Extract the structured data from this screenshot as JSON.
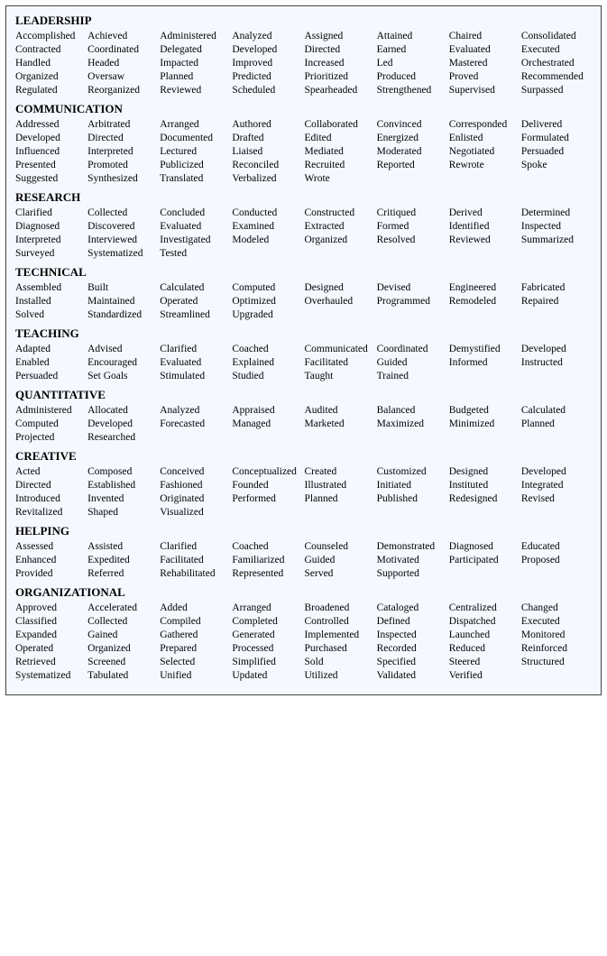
{
  "sections": [
    {
      "id": "leadership",
      "title": "LEADERSHIP",
      "words": [
        "Accomplished",
        "Achieved",
        "Administered",
        "Analyzed",
        "Assigned",
        "Attained",
        "Chaired",
        "Consolidated",
        "Contracted",
        "Coordinated",
        "Delegated",
        "Developed",
        "Directed",
        "Earned",
        "Evaluated",
        "Executed",
        "Handled",
        "Headed",
        "Impacted",
        "Improved",
        "Increased",
        "Led",
        "Mastered",
        "Orchestrated",
        "Organized",
        "Oversaw",
        "Planned",
        "Predicted",
        "Prioritized",
        "Produced",
        "Proved",
        "Recommended",
        "Regulated",
        "Reorganized",
        "Reviewed",
        "Scheduled",
        "Spearheaded",
        "Strengthened",
        "Supervised",
        "Surpassed"
      ]
    },
    {
      "id": "communication",
      "title": "COMMUNICATION",
      "words": [
        "Addressed",
        "Arbitrated",
        "Arranged",
        "Authored",
        "Collaborated",
        "Convinced",
        "Corresponded",
        "Delivered",
        "Developed",
        "Directed",
        "Documented",
        "Drafted",
        "Edited",
        "Energized",
        "Enlisted",
        "Formulated",
        "Influenced",
        "Interpreted",
        "Lectured",
        "Liaised",
        "Mediated",
        "Moderated",
        "Negotiated",
        "Persuaded",
        "Presented",
        "Promoted",
        "Publicized",
        "Reconciled",
        "Recruited",
        "Reported",
        "Rewrote",
        "Spoke",
        "Suggested",
        "Synthesized",
        "Translated",
        "Verbalized",
        "Wrote",
        "",
        "",
        ""
      ]
    },
    {
      "id": "research",
      "title": "RESEARCH",
      "words": [
        "Clarified",
        "Collected",
        "Concluded",
        "Conducted",
        "Constructed",
        "Critiqued",
        "Derived",
        "Determined",
        "Diagnosed",
        "Discovered",
        "Evaluated",
        "Examined",
        "Extracted",
        "Formed",
        "Identified",
        "Inspected",
        "Interpreted",
        "Interviewed",
        "Investigated",
        "Modeled",
        "Organized",
        "Resolved",
        "Reviewed",
        "Summarized",
        "Surveyed",
        "Systematized",
        "Tested",
        "",
        "",
        "",
        "",
        ""
      ]
    },
    {
      "id": "technical",
      "title": "TECHNICAL",
      "words": [
        "Assembled",
        "Built",
        "Calculated",
        "Computed",
        "Designed",
        "Devised",
        "Engineered",
        "Fabricated",
        "Installed",
        "Maintained",
        "Operated",
        "Optimized",
        "Overhauled",
        "Programmed",
        "Remodeled",
        "Repaired",
        "Solved",
        "Standardized",
        "Streamlined",
        "Upgraded",
        "",
        "",
        "",
        ""
      ]
    },
    {
      "id": "teaching",
      "title": "TEACHING",
      "words": [
        "Adapted",
        "Advised",
        "Clarified",
        "Coached",
        "Communicated",
        "Coordinated",
        "Demystified",
        "Developed",
        "Enabled",
        "Encouraged",
        "Evaluated",
        "Explained",
        "Facilitated",
        "Guided",
        "Informed",
        "Instructed",
        "Persuaded",
        "Set Goals",
        "Stimulated",
        "Studied",
        "Taught",
        "Trained",
        "",
        ""
      ]
    },
    {
      "id": "quantitative",
      "title": "QUANTITATIVE",
      "words": [
        "Administered",
        "Allocated",
        "Analyzed",
        "Appraised",
        "Audited",
        "Balanced",
        "Budgeted",
        "Calculated",
        "Computed",
        "Developed",
        "Forecasted",
        "Managed",
        "Marketed",
        "Maximized",
        "Minimized",
        "Planned",
        "Projected",
        "Researched",
        "",
        "",
        "",
        "",
        "",
        ""
      ]
    },
    {
      "id": "creative",
      "title": "CREATIVE",
      "words": [
        "Acted",
        "Composed",
        "Conceived",
        "Conceptualized",
        "Created",
        "Customized",
        "Designed",
        "Developed",
        "Directed",
        "Established",
        "Fashioned",
        "Founded",
        "Illustrated",
        "Initiated",
        "Instituted",
        "Integrated",
        "Introduced",
        "Invented",
        "Originated",
        "Performed",
        "Planned",
        "Published",
        "Redesigned",
        "Revised",
        "Revitalized",
        "Shaped",
        "Visualized",
        "",
        "",
        "",
        "",
        ""
      ]
    },
    {
      "id": "helping",
      "title": "HELPING",
      "words": [
        "Assessed",
        "Assisted",
        "Clarified",
        "Coached",
        "Counseled",
        "Demonstrated",
        "Diagnosed",
        "Educated",
        "Enhanced",
        "Expedited",
        "Facilitated",
        "Familiarized",
        "Guided",
        "Motivated",
        "Participated",
        "Proposed",
        "Provided",
        "Referred",
        "Rehabilitated",
        "Represented",
        "Served",
        "Supported",
        "",
        ""
      ]
    },
    {
      "id": "organizational",
      "title": "ORGANIZATIONAL",
      "words": [
        "Approved",
        "Accelerated",
        "Added",
        "Arranged",
        "Broadened",
        "Cataloged",
        "Centralized",
        "Changed",
        "Classified",
        "Collected",
        "Compiled",
        "Completed",
        "Controlled",
        "Defined",
        "Dispatched",
        "Executed",
        "Expanded",
        "Gained",
        "Gathered",
        "Generated",
        "Implemented",
        "Inspected",
        "Launched",
        "Monitored",
        "Operated",
        "Organized",
        "Prepared",
        "Processed",
        "Purchased",
        "Recorded",
        "Reduced",
        "Reinforced",
        "Retrieved",
        "Screened",
        "Selected",
        "Simplified",
        "Sold",
        "Specified",
        "Steered",
        "Structured",
        "Systematized",
        "Tabulated",
        "Unified",
        "Updated",
        "Utilized",
        "Validated",
        "Verified",
        ""
      ]
    }
  ]
}
